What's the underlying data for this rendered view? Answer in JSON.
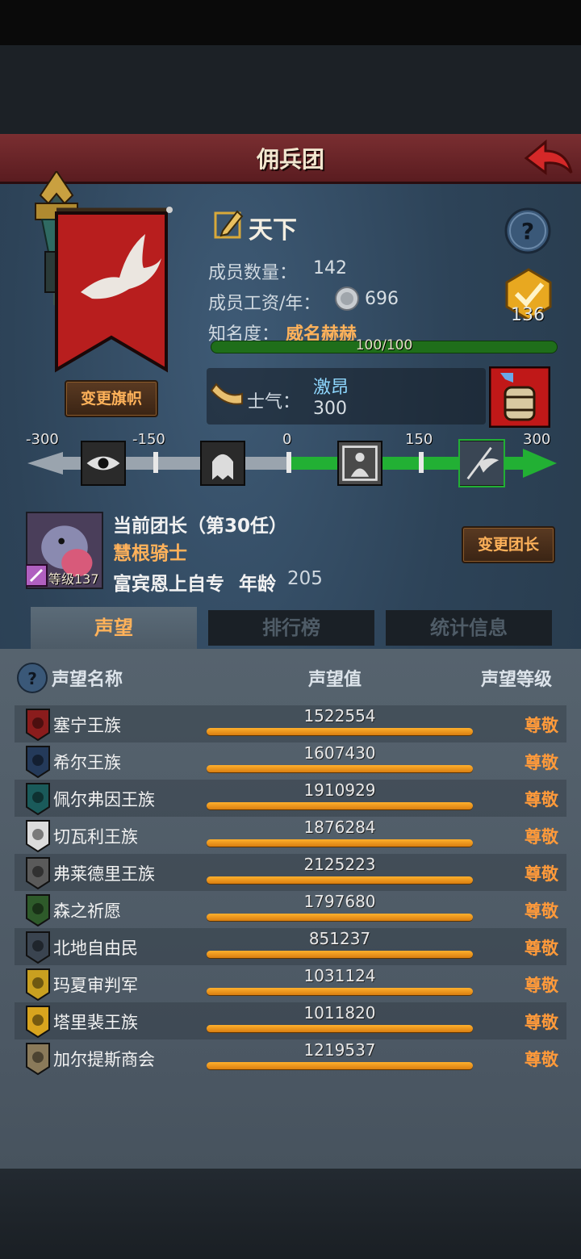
{
  "header": {
    "title": "佣兵团"
  },
  "guild": {
    "name": "天下",
    "change_flag_label": "变更旗帜",
    "members_label": "成员数量：",
    "members_value": "142",
    "salary_label": "成员工资/年：",
    "salary_value": "696",
    "fame_label": "知名度：",
    "fame_value": "威名赫赫",
    "fame_bar_text": "100/100",
    "fame_progress": 1.0,
    "coin_count": "136",
    "morale_label": "士气：",
    "morale_state": "激昂",
    "morale_value": "300"
  },
  "morale_scale": {
    "ticks": [
      "-300",
      "-150",
      "0",
      "150",
      "300"
    ],
    "current": 300,
    "icons": [
      "panic-eye-icon",
      "fear-ghost-icon",
      "calm-figure-icon",
      "charge-banner-icon"
    ]
  },
  "leader": {
    "title_line": "当前团长（第30任）",
    "name": "慧根骑士",
    "level_text": "等级137",
    "desc": "富宾恩上自专",
    "age_label": "年龄",
    "age_value": "205",
    "change_leader_label": "变更团长"
  },
  "tabs": [
    {
      "label": "声望",
      "active": true
    },
    {
      "label": "排行榜",
      "active": false
    },
    {
      "label": "统计信息",
      "active": false
    }
  ],
  "reputation": {
    "headers": {
      "name": "声望名称",
      "value": "声望值",
      "level": "声望等级"
    },
    "rows": [
      {
        "name": "塞宁王族",
        "value": "1522554",
        "level": "尊敬",
        "icon": "red-shield-icon",
        "color": "#8a1c1c"
      },
      {
        "name": "希尔王族",
        "value": "1607430",
        "level": "尊敬",
        "icon": "blue-helm-icon",
        "color": "#243a5a"
      },
      {
        "name": "佩尔弗因王族",
        "value": "1910929",
        "level": "尊敬",
        "icon": "teal-crescent-icon",
        "color": "#1a5a5a"
      },
      {
        "name": "切瓦利王族",
        "value": "1876284",
        "level": "尊敬",
        "icon": "white-scales-icon",
        "color": "#dcdcdc"
      },
      {
        "name": "弗莱德里王族",
        "value": "2125223",
        "level": "尊敬",
        "icon": "grey-skull-icon",
        "color": "#5a5a5a"
      },
      {
        "name": "森之祈愿",
        "value": "1797680",
        "level": "尊敬",
        "icon": "green-tree-icon",
        "color": "#2e5a2a"
      },
      {
        "name": "北地自由民",
        "value": "851237",
        "level": "尊敬",
        "icon": "slate-axe-icon",
        "color": "#3a4450"
      },
      {
        "name": "玛夏审判军",
        "value": "1031124",
        "level": "尊敬",
        "icon": "yellow-sword-icon",
        "color": "#c9a020"
      },
      {
        "name": "塔里裴王族",
        "value": "1011820",
        "level": "尊敬",
        "icon": "gold-crown-icon",
        "color": "#d8a41e"
      },
      {
        "name": "加尔提斯商会",
        "value": "1219537",
        "level": "尊敬",
        "icon": "tan-chest-icon",
        "color": "#8a7a5a"
      }
    ]
  },
  "colors": {
    "accent": "#ffb25a",
    "morale_positive": "#22b034",
    "fame_bar": "#1f6e1a",
    "rep_bar": "#f0a02a"
  }
}
